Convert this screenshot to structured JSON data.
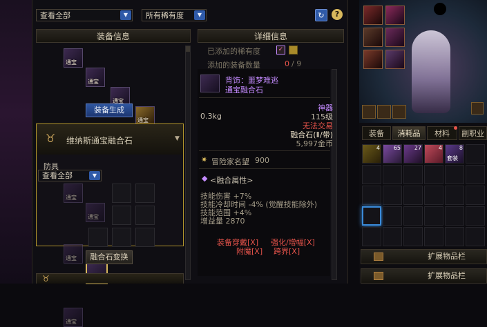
{
  "filters": {
    "category": "查看全部",
    "rarity": "所有稀有度"
  },
  "sections": {
    "equip_info": "装备信息",
    "detail_info": "详细信息"
  },
  "added": {
    "rarity_label": "已添加的稀有度",
    "count_label": "添加的装备数量",
    "count_value": "0",
    "count_max": "/ 9"
  },
  "equip_slots": [
    "通宝",
    "通宝",
    "通宝",
    "通宝",
    "通宝",
    "通宝",
    "通宝"
  ],
  "generate_button": "装备生成",
  "fusion": {
    "title": "维纳斯通宝融合石",
    "category_label": "防具",
    "category_value": "查看全部",
    "slot_tags": [
      "通宝",
      "通宝",
      "通宝",
      "通宝",
      "通宝"
    ],
    "exchange_button": "融合石变换"
  },
  "detail": {
    "item_slot": "背饰：噩梦难逃",
    "item_type": "通宝融合石",
    "weight": "0.3kg",
    "rarity": "神器",
    "level": "115级",
    "trade": "无法交易",
    "bind": "融合石(Ⅱ/带)",
    "price": "5,997金币",
    "fame_label": "冒险家名望",
    "fame_value": "900",
    "attr_title": "<融合属性>",
    "attrs": [
      "技能伤害 +7%",
      "技能冷却时间 -4% (觉醒技能除外)",
      "技能范围 +4%",
      "增益量 2870"
    ],
    "links": [
      "装备穿戴[X]",
      "强化/增幅[X]",
      "附魔[X]",
      "跨界[X]"
    ]
  },
  "right": {
    "tabs": [
      "装备",
      "消耗品",
      "材料",
      "副职业"
    ],
    "inv_counts": [
      "4",
      "65",
      "27",
      "4",
      "8"
    ],
    "inv_tag": "套装",
    "extend": [
      "扩展物品栏",
      "扩展物品栏"
    ]
  },
  "colors": {
    "accent_blue": "#2f5aa8",
    "gold": "#d8b85c",
    "purple": "#c48bff",
    "red": "#e8544b"
  }
}
